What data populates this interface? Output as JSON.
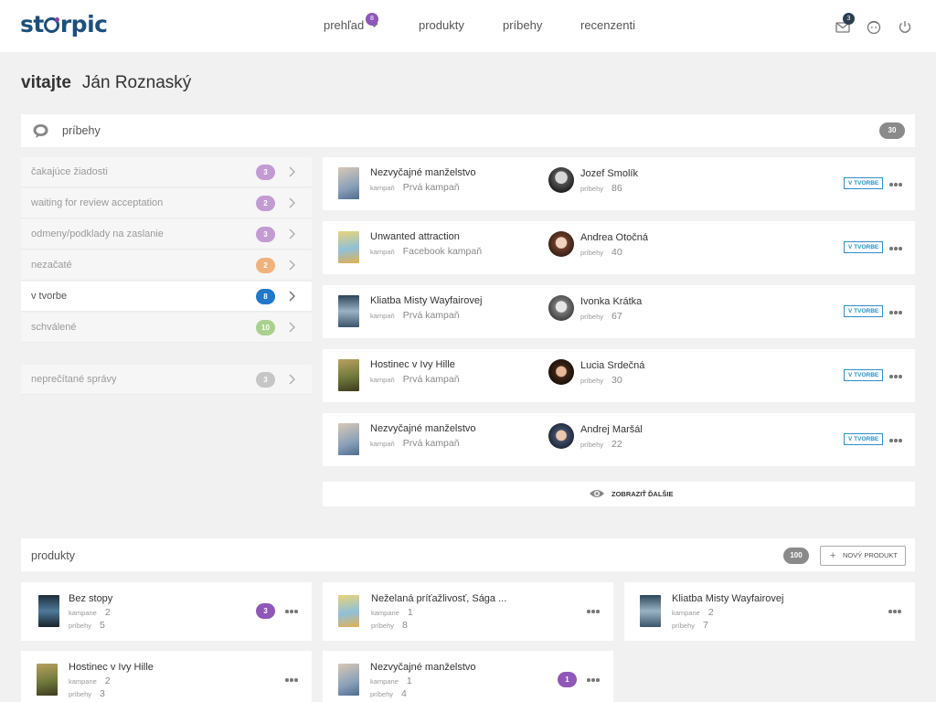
{
  "header": {
    "logo": "storpic",
    "nav": [
      {
        "label": "prehľad",
        "badge": "8"
      },
      {
        "label": "produkty"
      },
      {
        "label": "príbehy"
      },
      {
        "label": "recenzenti"
      }
    ],
    "mail_badge": "3",
    "icons": [
      "mail-icon",
      "avatar-icon",
      "power-icon"
    ]
  },
  "welcome": {
    "greeting": "vitajte",
    "user": "Ján Roznaský"
  },
  "stories": {
    "title": "príbehy",
    "count": "30",
    "filters": [
      {
        "label": "čakajúce žiadosti",
        "count": "3",
        "color": "#c39bd3"
      },
      {
        "label": "waiting for review acceptation",
        "count": "2",
        "color": "#c39bd3"
      },
      {
        "label": "odmeny/podklady na zaslanie",
        "count": "3",
        "color": "#c39bd3"
      },
      {
        "label": "nezačaté",
        "count": "2",
        "color": "#f0b27a"
      },
      {
        "label": "v tvorbe",
        "count": "8",
        "color": "#1f78c8"
      },
      {
        "label": "schválené",
        "count": "10",
        "color": "#a9d18e"
      }
    ],
    "unread": {
      "label": "neprečítané správy",
      "count": "3",
      "color": "#c6c6c6"
    },
    "items": [
      {
        "title": "Nezvyčajné manželstvo",
        "campaign_key": "kampaň",
        "campaign": "Prvá kampaň",
        "reviewer": "Jozef Smolík",
        "stories_key": "príbehy",
        "stories": "86",
        "status": "V TVORBE"
      },
      {
        "title": "Unwanted attraction",
        "campaign_key": "kampaň",
        "campaign": "Facebook kampaň",
        "reviewer": "Andrea Otočná",
        "stories_key": "príbehy",
        "stories": "40",
        "status": "V TVORBE"
      },
      {
        "title": "Kliatba Misty Wayfairovej",
        "campaign_key": "kampaň",
        "campaign": "Prvá kampaň",
        "reviewer": "Ivonka Krátka",
        "stories_key": "príbehy",
        "stories": "67",
        "status": "V TVORBE"
      },
      {
        "title": "Hostinec v Ivy Hille",
        "campaign_key": "kampaň",
        "campaign": "Prvá kampaň",
        "reviewer": "Lucia Srdečná",
        "stories_key": "príbehy",
        "stories": "30",
        "status": "V TVORBE"
      },
      {
        "title": "Nezvyčajné manželstvo",
        "campaign_key": "kampaň",
        "campaign": "Prvá kampaň",
        "reviewer": "Andrej Maršál",
        "stories_key": "príbehy",
        "stories": "22",
        "status": "V TVORBE"
      }
    ],
    "show_more": "ZOBRAZIŤ ĎALŠIE"
  },
  "products": {
    "title": "produkty",
    "count": "100",
    "new_button": "NOVÝ PRODUKT",
    "items": [
      {
        "title": "Bez stopy",
        "k1": "kampane",
        "campaigns": "2",
        "k2": "príbehy",
        "stories": "5",
        "badge": "3"
      },
      {
        "title": "Neželaná príťažlivosť, Sága ...",
        "k1": "kampane",
        "campaigns": "1",
        "k2": "príbehy",
        "stories": "8"
      },
      {
        "title": "Kliatba Misty Wayfairovej",
        "k1": "kampane",
        "campaigns": "2",
        "k2": "príbehy",
        "stories": "7"
      },
      {
        "title": "Hostinec v Ivy Hille",
        "k1": "kampane",
        "campaigns": "2",
        "k2": "príbehy",
        "stories": "3"
      },
      {
        "title": "Nezvyčajné manželstvo",
        "k1": "kampane",
        "campaigns": "1",
        "k2": "príbehy",
        "stories": "4",
        "badge": "1"
      }
    ]
  }
}
